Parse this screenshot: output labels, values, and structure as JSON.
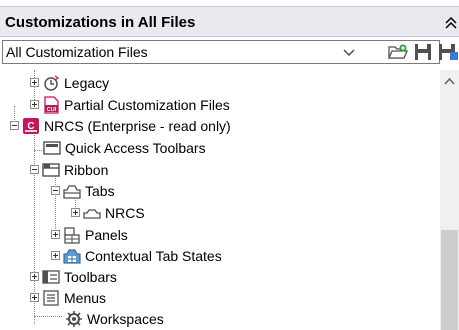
{
  "panel": {
    "title": "Customizations in All Files"
  },
  "toolbar": {
    "dropdown_value": "All Customization Files"
  },
  "tree": {
    "items": [
      {
        "label": "Legacy",
        "icon": "legacy-clock-icon",
        "state": "collapsed"
      },
      {
        "label": "Partial Customization Files",
        "icon": "cui-file-icon",
        "state": "collapsed"
      },
      {
        "label": "NRCS (Enterprise - read only)",
        "icon": "enterprise-cui-icon",
        "state": "expanded"
      },
      {
        "label": "Quick Access Toolbars",
        "icon": "quick-access-toolbar-icon",
        "state": "leaf"
      },
      {
        "label": "Ribbon",
        "icon": "ribbon-icon",
        "state": "expanded"
      },
      {
        "label": "Tabs",
        "icon": "tabs-icon",
        "state": "expanded"
      },
      {
        "label": "NRCS",
        "icon": "tab-icon",
        "state": "collapsed"
      },
      {
        "label": "Panels",
        "icon": "panels-icon",
        "state": "collapsed"
      },
      {
        "label": "Contextual Tab States",
        "icon": "contextual-tab-icon",
        "state": "collapsed"
      },
      {
        "label": "Toolbars",
        "icon": "toolbars-icon",
        "state": "collapsed"
      },
      {
        "label": "Menus",
        "icon": "menus-icon",
        "state": "collapsed"
      },
      {
        "label": "Workspaces",
        "icon": "workspaces-icon",
        "state": "leaf"
      }
    ]
  },
  "colors": {
    "header_bg": "#e9eaf0",
    "border": "#7a7a7a",
    "accent_magenta": "#c2185b",
    "icon_gray": "#505050"
  }
}
